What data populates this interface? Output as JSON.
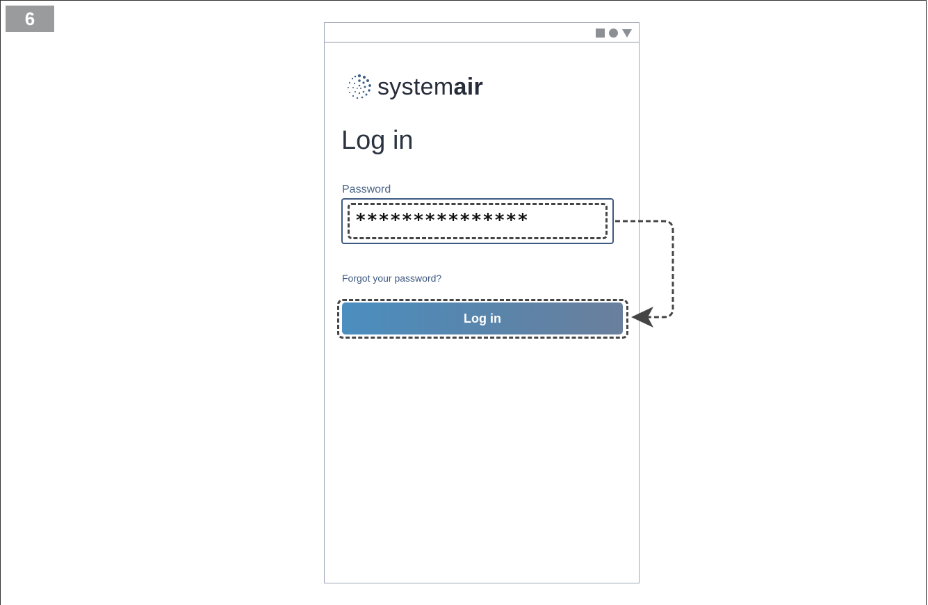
{
  "step": {
    "number": "6"
  },
  "brand": {
    "name_light": "system",
    "name_bold": "air"
  },
  "page": {
    "title": "Log in"
  },
  "password": {
    "label": "Password",
    "value": "***************"
  },
  "links": {
    "forgot": "Forgot your password?"
  },
  "buttons": {
    "login": "Log in"
  },
  "colors": {
    "accent": "#3d5a80",
    "button_start": "#4b8ebf",
    "button_end": "#6a7f9d",
    "badge": "#9a9b9d"
  }
}
